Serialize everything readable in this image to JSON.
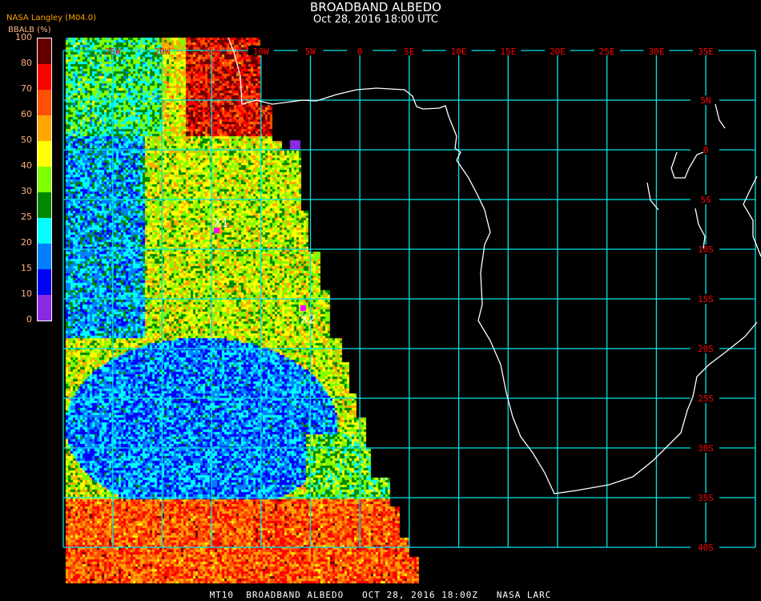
{
  "header": {
    "title": "BROADBAND ALBEDO",
    "subtitle": "Oct 28, 2016 18:00 UTC",
    "organization": "NASA Langley (M04.0)"
  },
  "colorbar": {
    "label": "BBALB (%)",
    "ticks": [
      "0",
      "10",
      "15",
      "20",
      "25",
      "30",
      "40",
      "50",
      "60",
      "70",
      "80",
      "100"
    ],
    "colors": [
      "#8a2be2",
      "#0000ff",
      "#0080ff",
      "#00ffff",
      "#008800",
      "#80ff00",
      "#ffff00",
      "#ffa500",
      "#ff5000",
      "#ff0000",
      "#660000"
    ]
  },
  "map": {
    "longitude_labels": [
      "25W",
      "20W",
      "15W",
      "10W",
      "5W",
      "0",
      "5E",
      "10E",
      "15E",
      "20E",
      "25E",
      "30E",
      "35E"
    ],
    "latitude_labels": [
      "5N",
      "0",
      "5S",
      "10S",
      "15S",
      "20S",
      "25S",
      "30S",
      "35S",
      "40S"
    ],
    "grid_color": "#00e5e5",
    "label_color": "#ff0000",
    "coastline_color": "#ffffff",
    "markers": [
      {
        "label": "X1",
        "color": "#ff00ff"
      },
      {
        "label": "X2",
        "color": "#ff00ff"
      }
    ]
  },
  "footer": "MT10  BROADBAND ALBEDO   OCT 28, 2016 18:00Z   NASA LARC"
}
